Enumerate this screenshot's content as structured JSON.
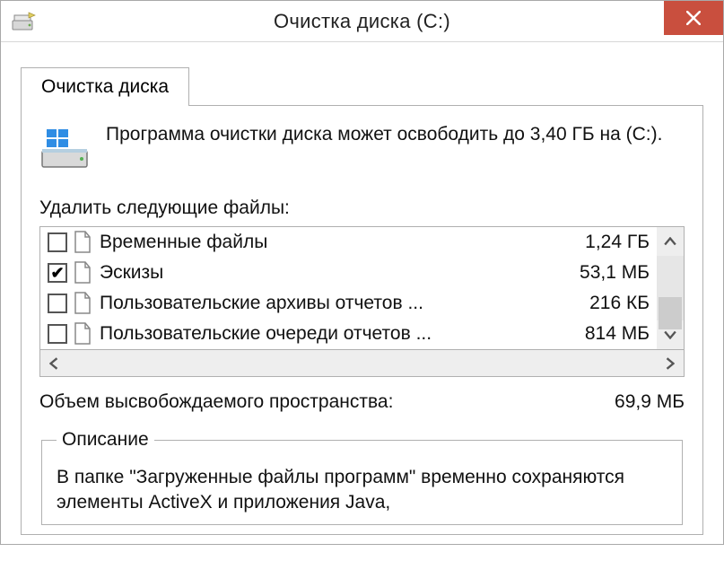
{
  "window": {
    "title": "Очистка диска  (C:)"
  },
  "tab": {
    "label": "Очистка диска"
  },
  "summary": "Программа очистки диска может освободить до 3,40 ГБ на  (C:).",
  "list_label": "Удалить следующие файлы:",
  "files": [
    {
      "checked": false,
      "name": "Временные файлы",
      "size": "1,24 ГБ"
    },
    {
      "checked": true,
      "name": "Эскизы",
      "size": "53,1 МБ"
    },
    {
      "checked": false,
      "name": "Пользовательские архивы отчетов ...",
      "size": "216 КБ"
    },
    {
      "checked": false,
      "name": "Пользовательские очереди отчетов ...",
      "size": "814 МБ"
    }
  ],
  "free_summary": {
    "label": "Объем высвобождаемого пространства:",
    "value": "69,9 МБ"
  },
  "description": {
    "legend": "Описание",
    "body": "В папке \"Загруженные файлы программ\" временно сохраняются элементы ActiveX и приложения Java,"
  }
}
